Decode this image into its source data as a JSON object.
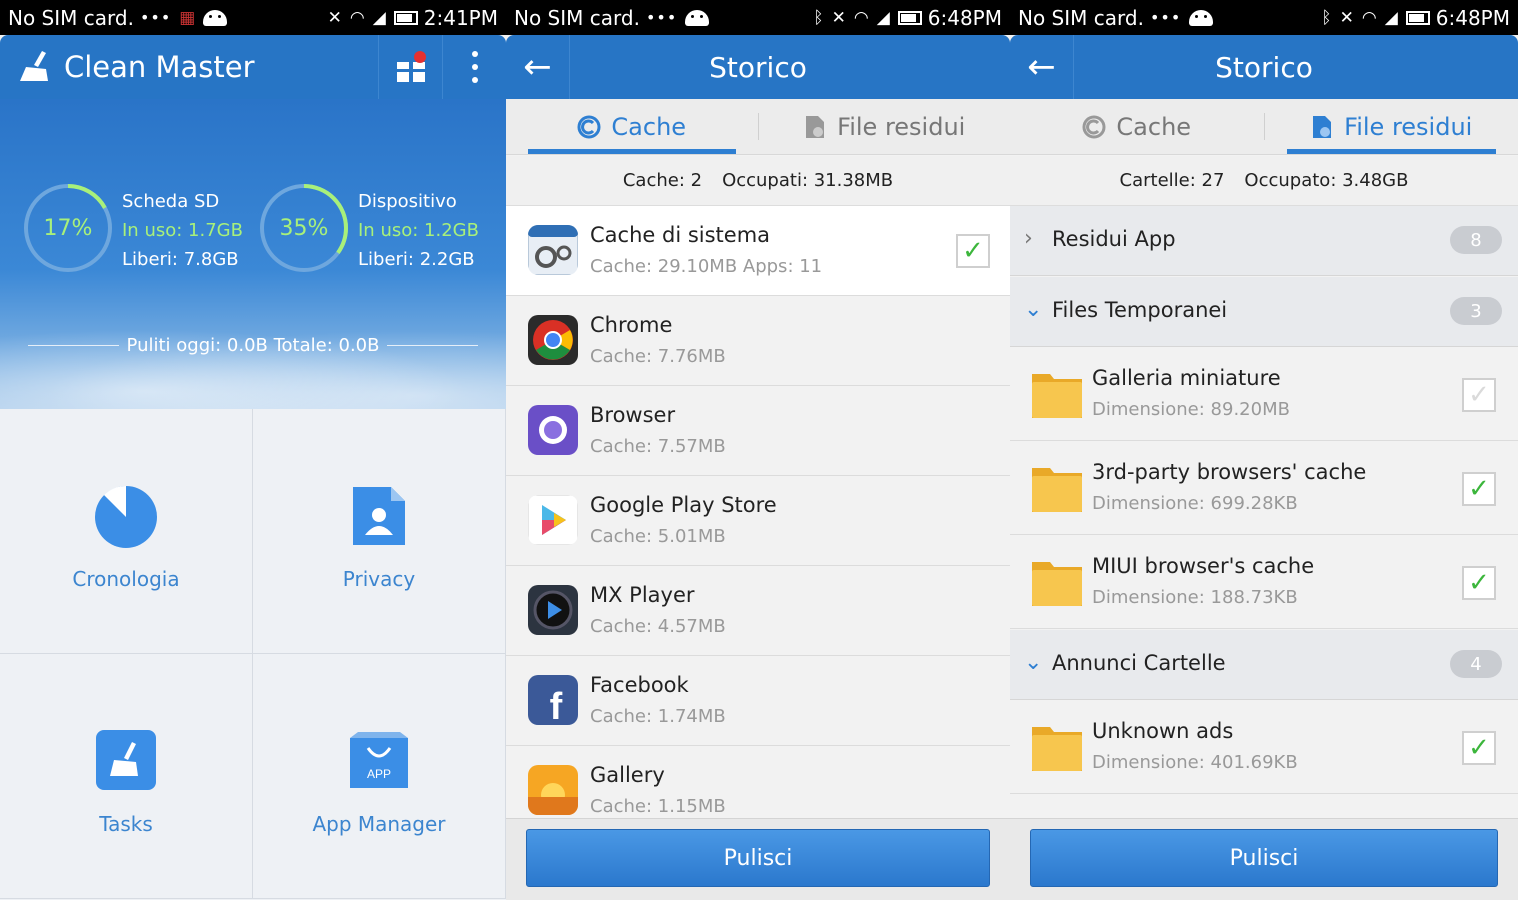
{
  "status_bars": [
    {
      "carrier": "No SIM card.",
      "dots": "•••",
      "time": "2:41PM"
    },
    {
      "carrier": "No SIM card.",
      "dots": "•••",
      "time": "6:48PM"
    },
    {
      "carrier": "No SIM card.",
      "dots": "•••",
      "time": "6:48PM"
    }
  ],
  "home": {
    "app_title": "Clean Master",
    "sd": {
      "percent": "17%",
      "label": "Scheda SD",
      "used": "In uso: 1.7GB",
      "free": "Liberi: 7.8GB",
      "fraction": 0.17
    },
    "device": {
      "percent": "35%",
      "label": "Dispositivo",
      "used": "In uso: 1.2GB",
      "free": "Liberi: 2.2GB",
      "fraction": 0.35
    },
    "cleaned": "Puliti oggi: 0.0B Totale: 0.0B",
    "tiles": [
      {
        "label": "Cronologia",
        "icon": "history-pie-icon"
      },
      {
        "label": "Privacy",
        "icon": "privacy-document-icon"
      },
      {
        "label": "Tasks",
        "icon": "tasks-broom-icon"
      },
      {
        "label": "App Manager",
        "icon": "app-manager-bag-icon"
      }
    ]
  },
  "cache_screen": {
    "title": "Storico",
    "tab_cache": "Cache",
    "tab_residual": "File residui",
    "summary_count": "Cache: 2",
    "summary_size": "Occupati: 31.38MB",
    "items": [
      {
        "name": "Cache di sistema",
        "sub": "Cache: 29.10MB   Apps: 11",
        "checked": true,
        "icon": "system-cache-gears-icon"
      },
      {
        "name": "Chrome",
        "sub": "Cache: 7.76MB",
        "icon": "chrome-icon"
      },
      {
        "name": "Browser",
        "sub": "Cache: 7.57MB",
        "icon": "browser-icon"
      },
      {
        "name": "Google Play Store",
        "sub": "Cache: 5.01MB",
        "icon": "play-store-icon"
      },
      {
        "name": "MX Player",
        "sub": "Cache: 4.57MB",
        "icon": "mx-player-icon"
      },
      {
        "name": "Facebook",
        "sub": "Cache: 1.74MB",
        "icon": "facebook-icon"
      },
      {
        "name": "Gallery",
        "sub": "Cache: 1.15MB",
        "icon": "gallery-icon"
      }
    ],
    "button": "Pulisci"
  },
  "residual_screen": {
    "title": "Storico",
    "tab_cache": "Cache",
    "tab_residual": "File residui",
    "summary_count": "Cartelle: 27",
    "summary_size": "Occupato: 3.48GB",
    "groups": {
      "app": {
        "name": "Residui App",
        "count": "8"
      },
      "temp": {
        "name": "Files Temporanei",
        "count": "3"
      },
      "ads": {
        "name": "Annunci Cartelle",
        "count": "4"
      }
    },
    "files": [
      {
        "name": "Galleria miniature",
        "sub": "Dimensione: 89.20MB",
        "checked": false
      },
      {
        "name": "3rd-party browsers' cache",
        "sub": "Dimensione: 699.28KB",
        "checked": true
      },
      {
        "name": "MIUI browser's cache",
        "sub": "Dimensione: 188.73KB",
        "checked": true
      },
      {
        "name": "Unknown ads",
        "sub": "Dimensione: 401.69KB",
        "checked": true
      }
    ],
    "button": "Pulisci"
  },
  "colors": {
    "accent": "#2775c5",
    "gauge_green": "#a8f07a",
    "check_green": "#3cb63c",
    "folder": "#f5c24a"
  }
}
